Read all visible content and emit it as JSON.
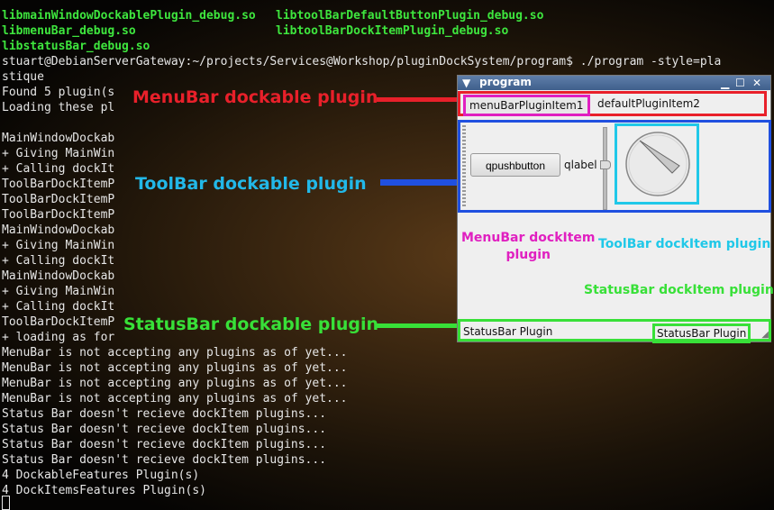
{
  "terminal": {
    "green_left": [
      "libmainWindowDockablePlugin_debug.so",
      "libmenuBar_debug.so",
      "libstatusBar_debug.so"
    ],
    "green_right": [
      "libtoolBarDefaultButtonPlugin_debug.so",
      "libtoolBarDockItemPlugin_debug.so"
    ],
    "lines": [
      "stuart@DebianServerGateway:~/projects/Services@Workshop/pluginDockSystem/program$ ./program -style=pla",
      "stique",
      "Found 5 plugin(s",
      "Loading these pl",
      "",
      "MainWindowDockab",
      "+ Giving MainWin",
      "+ Calling dockIt",
      "ToolBarDockItemP",
      "ToolBarDockItemP",
      "ToolBarDockItemP",
      "MainWindowDockab",
      "+ Giving MainWin",
      "+ Calling dockIt",
      "MainWindowDockab",
      "+ Giving MainWin",
      "+ Calling dockIt",
      "ToolBarDockItemP",
      "+ loading as for",
      "MenuBar is not accepting any plugins as of yet...",
      "MenuBar is not accepting any plugins as of yet...",
      "MenuBar is not accepting any plugins as of yet...",
      "MenuBar is not accepting any plugins as of yet...",
      "Status Bar doesn't recieve dockItem plugins...",
      "Status Bar doesn't recieve dockItem plugins...",
      "Status Bar doesn't recieve dockItem plugins...",
      "Status Bar doesn't recieve dockItem plugins...",
      "4 DockableFeatures Plugin(s)",
      "4 DockItemsFeatures Plugin(s)"
    ]
  },
  "callouts": {
    "menubar_dockable": "MenuBar dockable plugin",
    "toolbar_dockable": "ToolBar dockable plugin",
    "statusbar_dockable": "StatusBar dockable plugin",
    "menubar_dockitem": "MenuBar dockItem\nplugin",
    "toolbar_dockitem": "ToolBar dockItem plugin",
    "statusbar_dockitem": "StatusBar dockItem plugin"
  },
  "colors": {
    "red": "#e8202a",
    "blue": "#2050e0",
    "green": "#38e038",
    "magenta": "#e020c0",
    "cyan": "#20c8e8"
  },
  "window": {
    "title": "program",
    "menu_item_1": "menuBarPluginItem1",
    "menu_item_2": "defaultPluginItem2",
    "push_button": "qpushbutton",
    "label": "qlabel",
    "status_left": "StatusBar Plugin",
    "status_right": "StatusBar Plugin"
  }
}
